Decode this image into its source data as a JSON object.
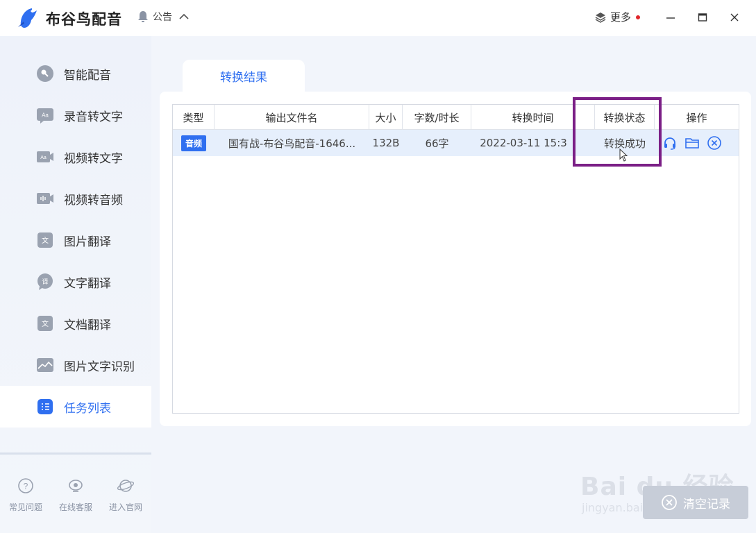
{
  "app": {
    "name": "布谷鸟配音",
    "notice_label": "公告",
    "more_label": "更多"
  },
  "sidebar": {
    "items": [
      {
        "label": "智能配音",
        "icon": "smart-voice-icon",
        "active": false
      },
      {
        "label": "录音转文字",
        "icon": "audio-to-text-icon",
        "active": false
      },
      {
        "label": "视频转文字",
        "icon": "video-to-text-icon",
        "active": false
      },
      {
        "label": "视频转音频",
        "icon": "video-to-audio-icon",
        "active": false
      },
      {
        "label": "图片翻译",
        "icon": "image-translate-icon",
        "active": false
      },
      {
        "label": "文字翻译",
        "icon": "text-translate-icon",
        "active": false
      },
      {
        "label": "文档翻译",
        "icon": "document-translate-icon",
        "active": false
      },
      {
        "label": "图片文字识别",
        "icon": "ocr-icon",
        "active": false
      },
      {
        "label": "任务列表",
        "icon": "task-list-icon",
        "active": true
      }
    ],
    "footer": [
      {
        "label": "常见问题",
        "icon": "help-icon"
      },
      {
        "label": "在线客服",
        "icon": "customer-service-icon"
      },
      {
        "label": "进入官网",
        "icon": "website-icon"
      }
    ]
  },
  "main": {
    "tab_label": "转换结果",
    "table": {
      "columns": [
        "类型",
        "输出文件名",
        "大小",
        "字数/时长",
        "转换时间",
        "转换状态",
        "操作"
      ],
      "rows": [
        {
          "type": "音频",
          "filename": "国有战-布谷鸟配音-1646...",
          "size": "132B",
          "length": "66字",
          "time": "2022-03-11 15:3",
          "status": "转换成功"
        }
      ]
    },
    "clear_label": "清空记录"
  },
  "watermark": {
    "text": "Bai du 经验",
    "sub": "jingyan.baidu.com"
  },
  "colors": {
    "accent": "#2f6ff0",
    "highlight": "#7b1f86",
    "badge": "#2f6ff0"
  }
}
